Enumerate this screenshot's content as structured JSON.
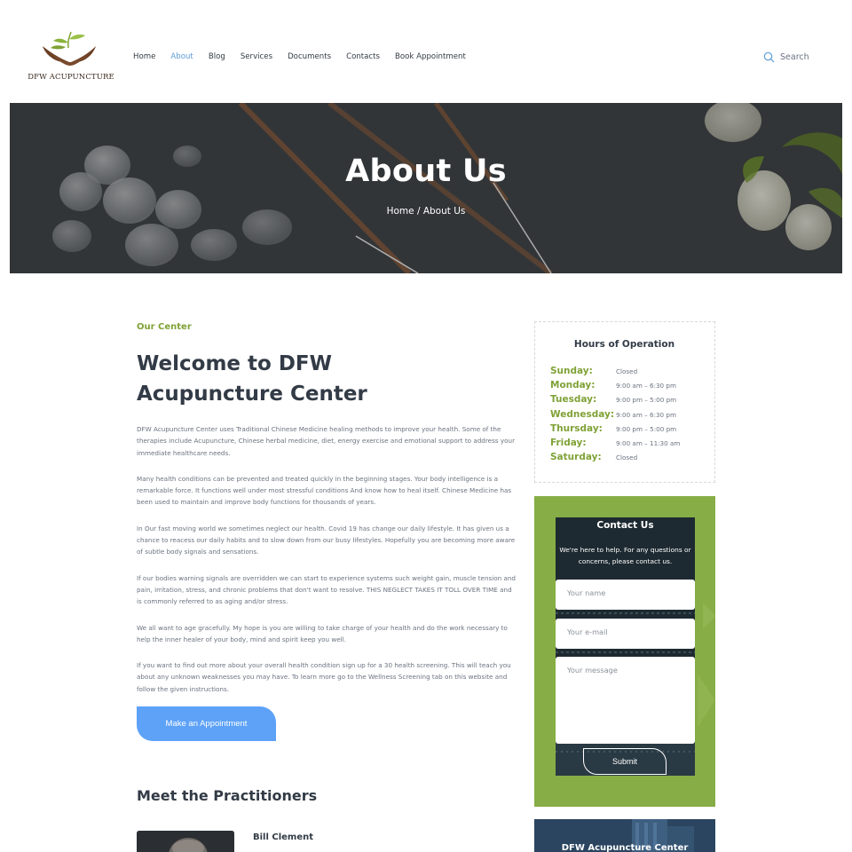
{
  "logo": {
    "text": "DFW ACUPUNCTURE"
  },
  "nav": {
    "items": [
      "Home",
      "About",
      "Blog",
      "Services",
      "Documents",
      "Contacts",
      "Book Appointment"
    ],
    "active": "About",
    "active_color": "#5b9bd5"
  },
  "search": {
    "label": "Search",
    "icon": "search-icon"
  },
  "hero": {
    "title": "About Us",
    "breadcrumb": "Home / About Us"
  },
  "main": {
    "eyebrow": "Our Center",
    "heading": "Welcome to DFW Acupuncture Center",
    "paragraphs": [
      "DFW Acupuncture Center uses Traditional Chinese Medicine healing methods to improve your health. Some of the therapies include Acupuncture, Chinese herbal medicine, diet, energy exercise and emotional support to address your immediate healthcare needs.",
      "Many health conditions can be prevented and treated quickly in the beginning stages. Your body intelligence is a remarkable force. It functions well under most stressful conditions And know how to heal itself. Chinese Medicine has been used to maintain and improve body functions for thousands of years.",
      "In Our fast moving world we sometimes neglect our health. Covid 19 has change our daily lifestyle. It has given us a chance to reacess our daily habits and to slow down from our busy lifestyles. Hopefully you are becoming more aware of subtle body signals and sensations.",
      "If our bodies warning signals are overridden we can start to experience systems such weight gain, muscle tension and pain, irritation, stress, and chronic problems that don't want to resolve. THIS NEGLECT TAKES IT TOLL OVER TIME and is commonly referred to as aging and/or stress.",
      "We all want to age gracefully. My hope is you are willing to take charge of your health and do the work necessary to help the inner healer of your body, mind and spirit keep you well.",
      "If you want to find out more about your overall health condition sign up for a 30 health screening. This will teach you about any unknown weaknesses you may have. To learn more go to the Wellness Screening tab on this website and follow the given instructions."
    ],
    "appointment_button": "Make an Appointment",
    "practitioners_heading": "Meet the Practitioners",
    "practitioner_name": "Bill Clement"
  },
  "hours": {
    "title": "Hours of Operation",
    "rows": [
      {
        "day": "Sunday:",
        "time": "Closed"
      },
      {
        "day": "Monday:",
        "time": "9:00 am – 6:30 pm"
      },
      {
        "day": "Tuesday:",
        "time": "9:00 pm – 5:00 pm"
      },
      {
        "day": "Wednesday:",
        "time": "9:00 am – 6:30 pm"
      },
      {
        "day": "Thursday:",
        "time": "9:00 pm – 5:00 pm"
      },
      {
        "day": "Friday:",
        "time": "9:00 am – 11:30 am"
      },
      {
        "day": "Saturday:",
        "time": "Closed"
      }
    ]
  },
  "contact": {
    "title": "Contact Us",
    "description": "We're here to help. For any questions or concerns, please contact us.",
    "name_placeholder": "Your name",
    "email_placeholder": "Your e-mail",
    "message_placeholder": "Your message",
    "submit_label": "Submit"
  },
  "center_card": {
    "title": "DFW Acupuncture Center"
  },
  "colors": {
    "green": "#7fa236",
    "blue_button": "#5da2f7",
    "contact_bg": "#87ad46",
    "heading": "#323b46"
  }
}
